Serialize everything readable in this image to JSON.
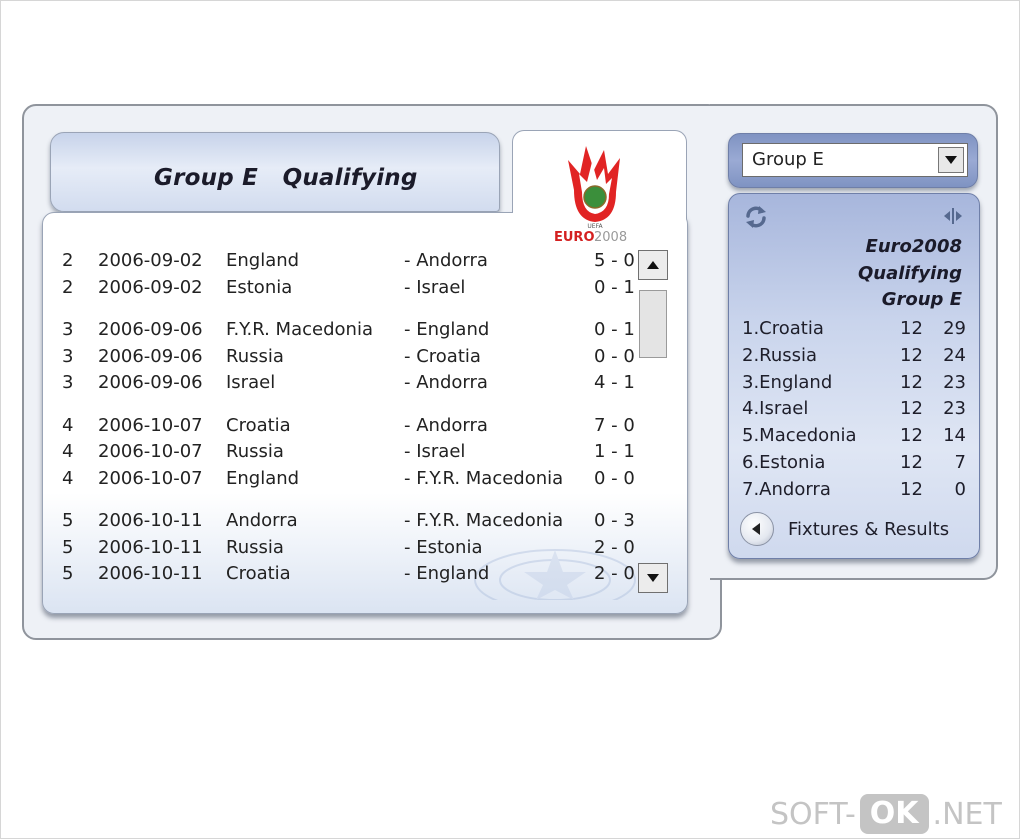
{
  "header": {
    "group": "Group E",
    "qualifying": "Qualifying",
    "logo_text_red": "EURO",
    "logo_text_grey": "2008",
    "logo_small": "UEFA"
  },
  "fixtures": [
    {
      "round": "2",
      "date": "2006-09-02",
      "home": "England",
      "away": "- Andorra",
      "score": "5 - 0"
    },
    {
      "round": "2",
      "date": "2006-09-02",
      "home": "Estonia",
      "away": "- Israel",
      "score": "0 - 1"
    },
    {
      "round": "3",
      "date": "2006-09-06",
      "home": "F.Y.R. Macedonia",
      "away": "- England",
      "score": "0 - 1"
    },
    {
      "round": "3",
      "date": "2006-09-06",
      "home": "Russia",
      "away": "- Croatia",
      "score": "0 - 0"
    },
    {
      "round": "3",
      "date": "2006-09-06",
      "home": "Israel",
      "away": "- Andorra",
      "score": "4 - 1"
    },
    {
      "round": "4",
      "date": "2006-10-07",
      "home": "Croatia",
      "away": "- Andorra",
      "score": "7 - 0"
    },
    {
      "round": "4",
      "date": "2006-10-07",
      "home": "Russia",
      "away": "- Israel",
      "score": "1 - 1"
    },
    {
      "round": "4",
      "date": "2006-10-07",
      "home": "England",
      "away": "- F.Y.R. Macedonia",
      "score": "0 - 0"
    },
    {
      "round": "5",
      "date": "2006-10-11",
      "home": "Andorra",
      "away": "- F.Y.R. Macedonia",
      "score": "0 - 3"
    },
    {
      "round": "5",
      "date": "2006-10-11",
      "home": "Russia",
      "away": "- Estonia",
      "score": "2 - 0"
    },
    {
      "round": "5",
      "date": "2006-10-11",
      "home": "Croatia",
      "away": "- England",
      "score": "2 - 0"
    }
  ],
  "group_select": {
    "value": "Group E"
  },
  "standings": {
    "title_lines": [
      "Euro2008",
      "Qualifying",
      "Group E"
    ],
    "rows": [
      {
        "team": "1.Croatia",
        "played": "12",
        "points": "29"
      },
      {
        "team": "2.Russia",
        "played": "12",
        "points": "24"
      },
      {
        "team": "3.England",
        "played": "12",
        "points": "23"
      },
      {
        "team": "4.Israel",
        "played": "12",
        "points": "23"
      },
      {
        "team": "5.Macedonia",
        "played": "12",
        "points": "14"
      },
      {
        "team": "6.Estonia",
        "played": "12",
        "points": "7"
      },
      {
        "team": "7.Andorra",
        "played": "12",
        "points": "0"
      }
    ]
  },
  "links": {
    "fixtures_results": "Fixtures & Results"
  },
  "watermark": {
    "left": "SOFT-",
    "box": "OK",
    "right": ".NET"
  },
  "icons": {
    "refresh": "refresh-icon",
    "resize": "resize-icon",
    "back": "chevron-left-icon",
    "scroll_up": "arrow-up-icon",
    "scroll_down": "arrow-down-icon",
    "dropdown": "chevron-down-icon"
  }
}
